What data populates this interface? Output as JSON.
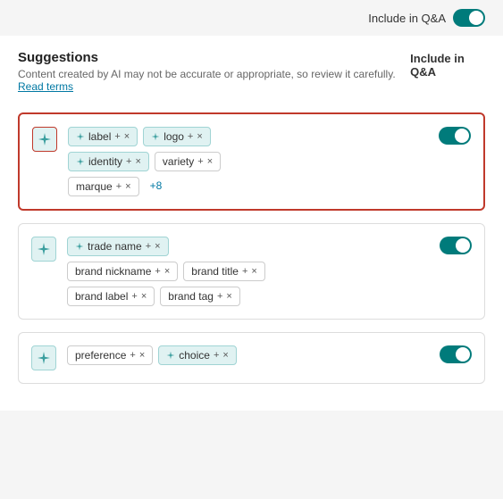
{
  "topBar": {
    "toggleLabel": "Include in Q&A",
    "toggleEnabled": true
  },
  "suggestions": {
    "title": "Suggestions",
    "subtitle": "Content created by AI may not be accurate or appropriate, so review it carefully.",
    "readTermsLabel": "Read terms",
    "columnLabel": "Include in Q&A"
  },
  "cards": [
    {
      "id": "card-1",
      "isFirst": true,
      "toggleEnabled": true,
      "tagsRows": [
        [
          {
            "text": "label",
            "isAi": true,
            "hasPlus": true,
            "hasX": true
          },
          {
            "text": "logo",
            "isAi": true,
            "hasPlus": true,
            "hasX": true
          }
        ],
        [
          {
            "text": "identity",
            "isAi": true,
            "hasPlus": true,
            "hasX": true
          },
          {
            "text": "variety",
            "hasPlus": true,
            "hasX": true
          }
        ],
        [
          {
            "text": "marque",
            "hasPlus": true,
            "hasX": true
          },
          {
            "text": "+8",
            "isMore": true
          }
        ]
      ]
    },
    {
      "id": "card-2",
      "isFirst": false,
      "toggleEnabled": true,
      "tagsRows": [
        [
          {
            "text": "trade name",
            "isAi": true,
            "hasPlus": true,
            "hasX": true
          }
        ],
        [
          {
            "text": "brand nickname",
            "hasPlus": true,
            "hasX": true
          },
          {
            "text": "brand title",
            "hasPlus": true,
            "hasX": true
          }
        ],
        [
          {
            "text": "brand label",
            "hasPlus": true,
            "hasX": true
          },
          {
            "text": "brand tag",
            "hasPlus": true,
            "hasX": true
          }
        ]
      ]
    },
    {
      "id": "card-3",
      "isFirst": false,
      "toggleEnabled": true,
      "tagsRows": [
        [
          {
            "text": "preference",
            "hasPlus": true,
            "hasX": true
          },
          {
            "text": "choice",
            "isAi": true,
            "hasPlus": true,
            "hasX": true
          }
        ]
      ]
    }
  ],
  "icons": {
    "sparkle": "sparkle",
    "toggle": "toggle",
    "plus": "+",
    "close": "×"
  }
}
